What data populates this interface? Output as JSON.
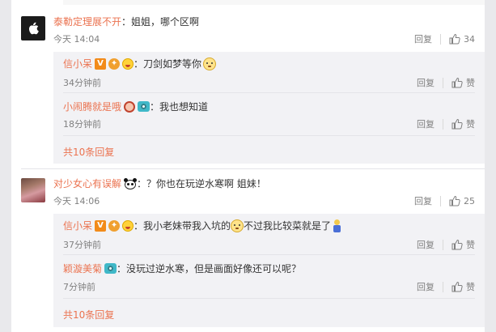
{
  "comments": [
    {
      "author": "泰勒定理展不开",
      "text": "：姐姐，哪个区啊",
      "time": "今天 14:04",
      "reply_label": "回复",
      "likes": "34",
      "replies": [
        {
          "author": "信小呆",
          "text": "：刀剑如梦等你",
          "time": "34分钟前",
          "reply_label": "回复",
          "like_label": "赞"
        },
        {
          "author": "小闹腾就是哦",
          "text": "：我也想知道",
          "time": "18分钟前",
          "reply_label": "回复",
          "like_label": "赞"
        }
      ],
      "more_label": "共10条回复"
    },
    {
      "author": "对少女心有误解",
      "text": "：？你也在玩逆水寒啊 姐妹！",
      "time": "今天 14:06",
      "reply_label": "回复",
      "likes": "25",
      "replies": [
        {
          "author": "信小呆",
          "text_a": "：我小老妹带我入坑的",
          "text_b": "不过我比较菜就是了",
          "time": "37分钟前",
          "reply_label": "回复",
          "like_label": "赞"
        },
        {
          "author": "颖漩美菊",
          "text": "：没玩过逆水寒，但是画面好像还可以呢？",
          "time": "7分钟前",
          "reply_label": "回复",
          "like_label": "赞"
        }
      ],
      "more_label": "共10条回复"
    }
  ],
  "icons": {
    "like": "thumbs-up-icon",
    "vip": "vip-badge-icon"
  },
  "colors": {
    "name": "#eb7350",
    "background": "#f2f2f5",
    "reply_box": "#f2f2f5"
  }
}
